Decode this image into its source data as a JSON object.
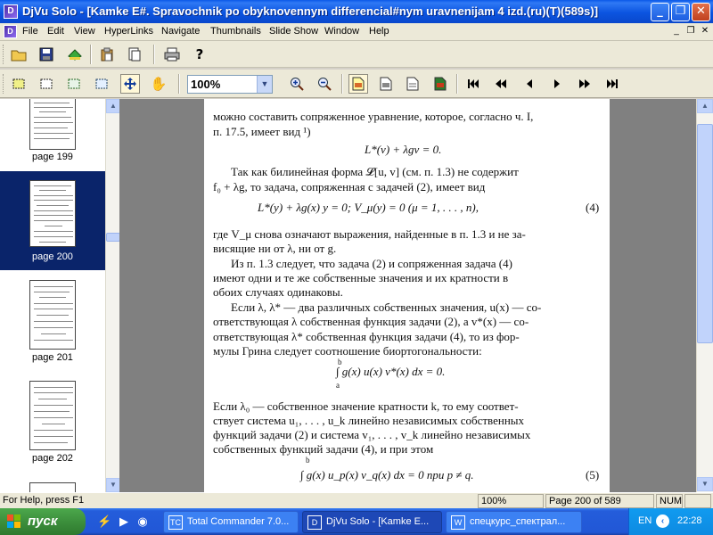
{
  "window": {
    "title": "DjVu Solo - [Kamke E#. Spravochnik po obyknovennym differencial#nym uravnenijam 4 izd.(ru)(T)(589s)]",
    "app_icon": "djvu-icon",
    "caption_buttons": [
      "_",
      "❐",
      "✕"
    ]
  },
  "menu": [
    "File",
    "Edit",
    "View",
    "HyperLinks",
    "Navigate",
    "Thumbnails",
    "Slide Show",
    "Window",
    "Help"
  ],
  "mdi_buttons": [
    "_",
    "❐",
    "✕"
  ],
  "toolbar": {
    "zoom": "100%"
  },
  "thumbnails": [
    {
      "label": "page 199",
      "selected": false
    },
    {
      "label": "page 200",
      "selected": true
    },
    {
      "label": "page 201",
      "selected": false
    },
    {
      "label": "page 202",
      "selected": false
    }
  ],
  "document": {
    "lines": [
      "можно составить сопряженное уравнение, которое, согласно ч. I,",
      "п. 17.5, имеет вид ¹)",
      "L*(v) + λgv = 0.",
      "Так как билинейная форма 𝓛[u, v] (см. п. 1.3) не содержит",
      "f₀ + λg, то задача, сопряженная с задачей (2), имеет вид",
      "L*(y) + λg(x) y = 0;    V_μ(y) = 0        (μ = 1, . . . , n),",
      "(4)",
      "где V_μ снова означают выражения, найденные в п. 1.3 и не за-",
      "висящие ни от λ, ни от g.",
      "Из п. 1.3 следует, что задача (2) и сопряженная задача (4)",
      "имеют одни и те же собственные значения и их кратности в",
      "обоих случаях одинаковы.",
      "Если λ, λ* — два различных собственных значения, u(x) — со-",
      "ответствующая λ собственная функция задачи (2), а v*(x) — со-",
      "ответствующая λ* собственная функция задачи (4), то из фор-",
      "мулы Грина следует соотношение биортогональности:",
      "∫ g(x) u(x) v*(x) dx = 0.",
      "b",
      "a",
      "Если λ₀ — собственное значение кратности k, то ему соответ-",
      "ствует система u₁, . . . , u_k линейно независимых собственных",
      "функций задачи (2) и система v₁, . . . , v_k линейно независимых",
      "собственных функций задачи (4), и при этом",
      "∫ g(x) u_p(x) v_q(x) dx = 0    при    p ≠ q.",
      "(5)",
      "b"
    ]
  },
  "status": {
    "help": "For Help, press F1",
    "zoom": "100%",
    "page": "Page 200 of 589",
    "num": "NUM"
  },
  "taskbar": {
    "start": "пуск",
    "tasks": [
      "Total Commander 7.0...",
      "DjVu Solo - [Kamke E...",
      "спецкурс_спектрал..."
    ],
    "lang": "EN",
    "clock": "22:28"
  }
}
